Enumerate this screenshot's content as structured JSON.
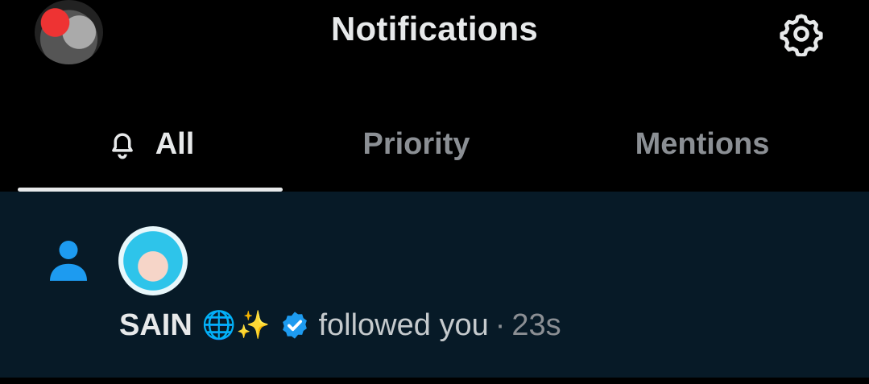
{
  "header": {
    "title": "Notifications",
    "profile_avatar_icon": "user-avatar",
    "settings_icon": "gear-icon"
  },
  "tabs": [
    {
      "label": "All",
      "icon": "bell-icon",
      "active": true
    },
    {
      "label": "Priority",
      "active": false
    },
    {
      "label": "Mentions",
      "active": false
    }
  ],
  "notifications": [
    {
      "type_icon": "person-icon",
      "user_name": "SAIN",
      "user_emoji": "🌐✨",
      "verified": true,
      "action": "followed you",
      "separator": "·",
      "time": "23s"
    }
  ],
  "colors": {
    "background": "#000000",
    "notification_bg": "#071a27",
    "accent": "#1d9bf0",
    "text_primary": "#e7e9ea",
    "text_secondary": "#8b8f94"
  }
}
